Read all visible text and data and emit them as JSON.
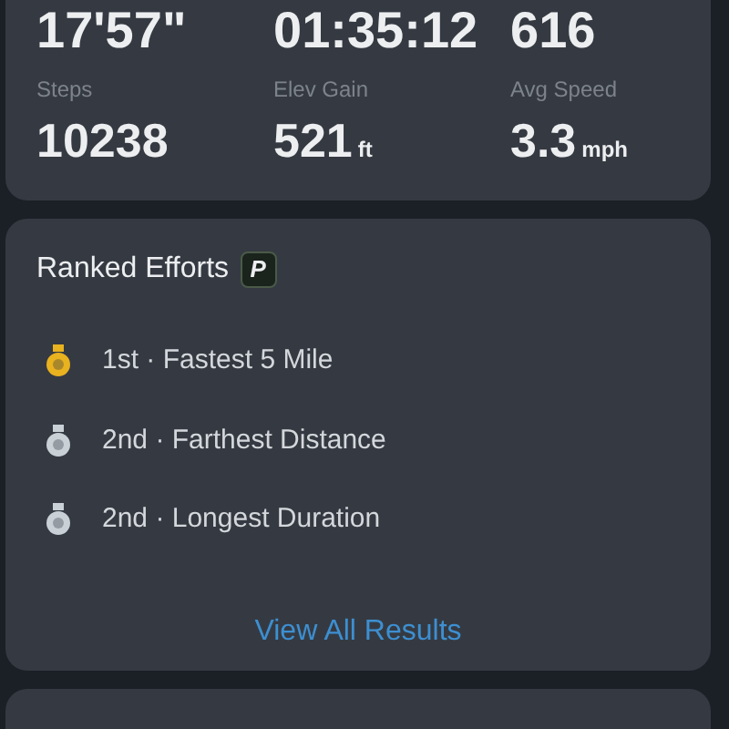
{
  "summary_top_values": [
    {
      "value": "17'57\""
    },
    {
      "value": "01:35:12"
    },
    {
      "value": "616"
    }
  ],
  "summary_stats": [
    {
      "label": "Steps",
      "value": "10238"
    },
    {
      "label": "Elev Gain",
      "value": "521",
      "unit": "ft"
    },
    {
      "label": "Avg Speed",
      "value": "3.3",
      "unit": "mph"
    }
  ],
  "ranked_efforts": {
    "title": "Ranked Efforts",
    "badge": "P",
    "items": [
      {
        "text": "1st · Fastest 5 Mile",
        "color": "#e9b21f"
      },
      {
        "text": "2nd · Farthest Distance",
        "color": "#c9d0d6"
      },
      {
        "text": "2nd · Longest Duration",
        "color": "#c9d0d6"
      }
    ],
    "link": "View All Results"
  }
}
